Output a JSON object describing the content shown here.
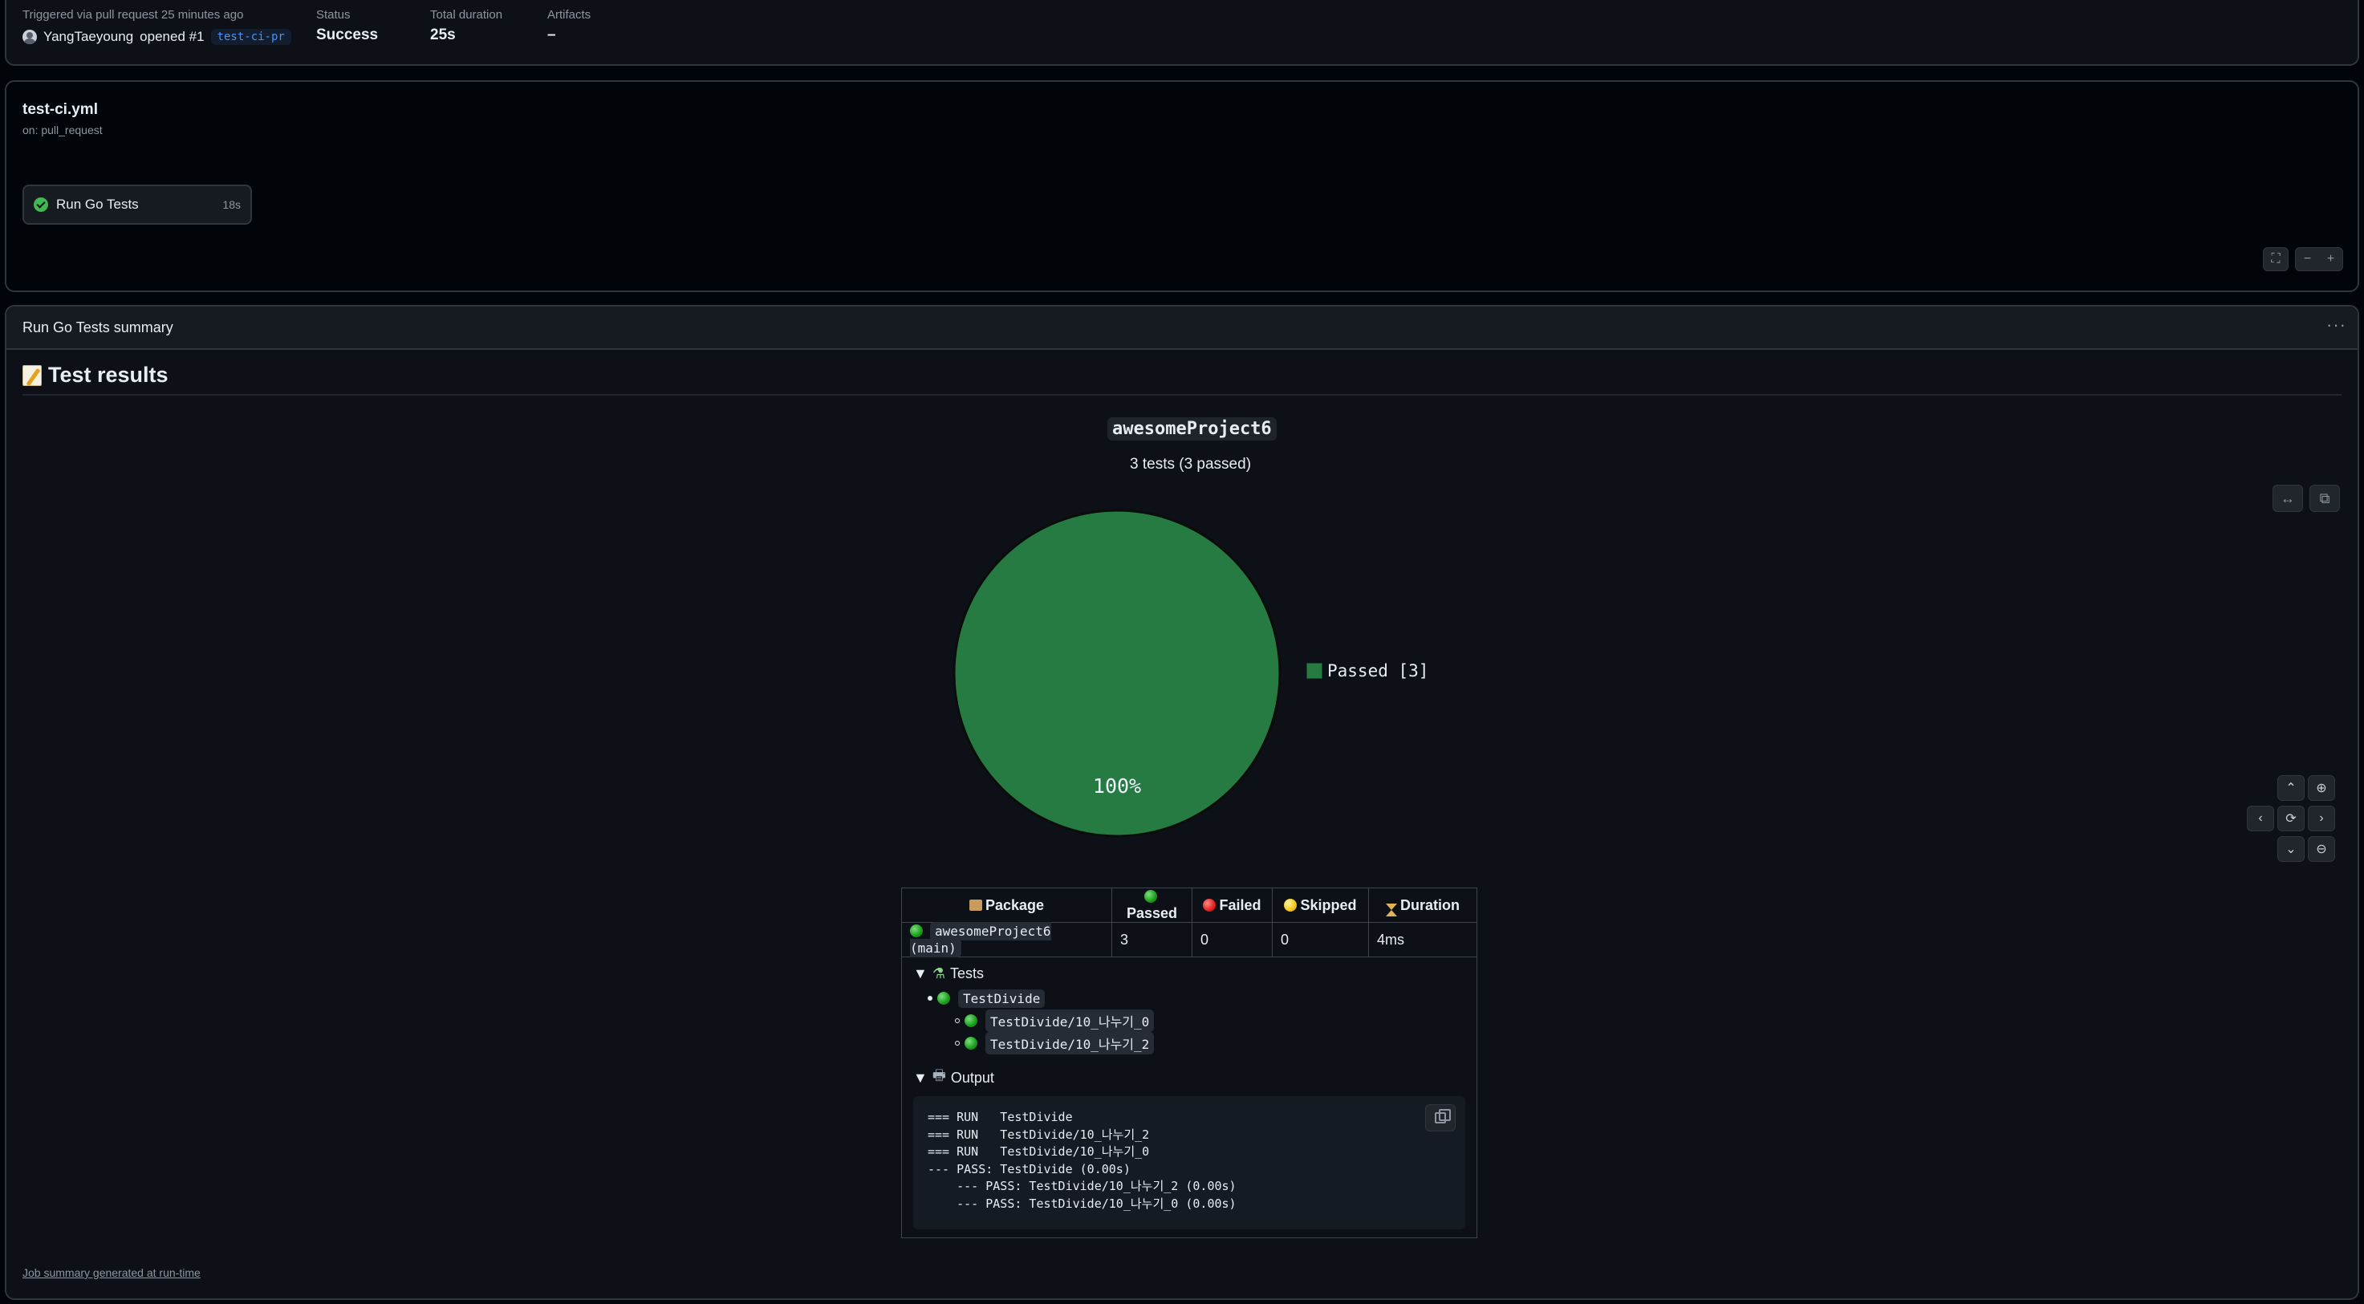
{
  "run_meta": {
    "trigger_text": "Triggered via pull request 25 minutes ago",
    "actor": "YangTaeyoung",
    "action": "opened #1",
    "branch": "test-ci-pr",
    "status_label": "Status",
    "status_value": "Success",
    "duration_label": "Total duration",
    "duration_value": "25s",
    "artifacts_label": "Artifacts",
    "artifacts_value": "–"
  },
  "workflow": {
    "file": "test-ci.yml",
    "event": "on: pull_request",
    "job": {
      "name": "Run Go Tests",
      "duration": "18s",
      "status": "success",
      "icon": "check-circle-icon"
    },
    "controls": {
      "fullscreen": "⛶",
      "zoom_out": "−",
      "zoom_in": "+"
    }
  },
  "summary": {
    "title": "Run Go Tests summary",
    "menu": "···",
    "heading": "Test results",
    "heading_icon": "memo-icon",
    "project_title": "awesomeProject6",
    "project_subtitle": "3 tests (3 passed)",
    "pie_label": "100%",
    "legend": "Passed [3]",
    "controls": {
      "fit": "↔",
      "copy": "⧉",
      "nav": {
        "up": "⌃",
        "down": "⌄",
        "left": "‹",
        "right": "›",
        "reset": "⟳",
        "zoom_in": "⊕",
        "zoom_out": "⊖"
      }
    },
    "table": {
      "headers": {
        "package": "Package",
        "passed": "Passed",
        "failed": "Failed",
        "skipped": "Skipped",
        "duration": "Duration"
      },
      "row": {
        "package": "awesomeProject6 (main)",
        "passed": "3",
        "failed": "0",
        "skipped": "0",
        "duration": "4ms"
      },
      "tests_label": "Tests",
      "tests": {
        "parent": "TestDivide",
        "children": [
          "TestDivide/10_나누기_0",
          "TestDivide/10_나누기_2"
        ]
      },
      "output_label": "Output",
      "output_lines": [
        "=== RUN   TestDivide",
        "=== RUN   TestDivide/10_나누기_2",
        "=== RUN   TestDivide/10_나누기_0",
        "--- PASS: TestDivide (0.00s)",
        "    --- PASS: TestDivide/10_나누기_2 (0.00s)",
        "    --- PASS: TestDivide/10_나누기_0 (0.00s)"
      ]
    },
    "footer": "Job summary generated at run-time"
  },
  "chart_data": {
    "type": "pie",
    "categories": [
      "Passed"
    ],
    "values": [
      3
    ],
    "title": "",
    "colors": [
      "#267b42"
    ]
  },
  "colors": {
    "background": "#010409",
    "panel": "#0d1117",
    "border": "#30363d",
    "success": "#3fb950",
    "pie_passed": "#267b42",
    "link": "#4493f8"
  }
}
